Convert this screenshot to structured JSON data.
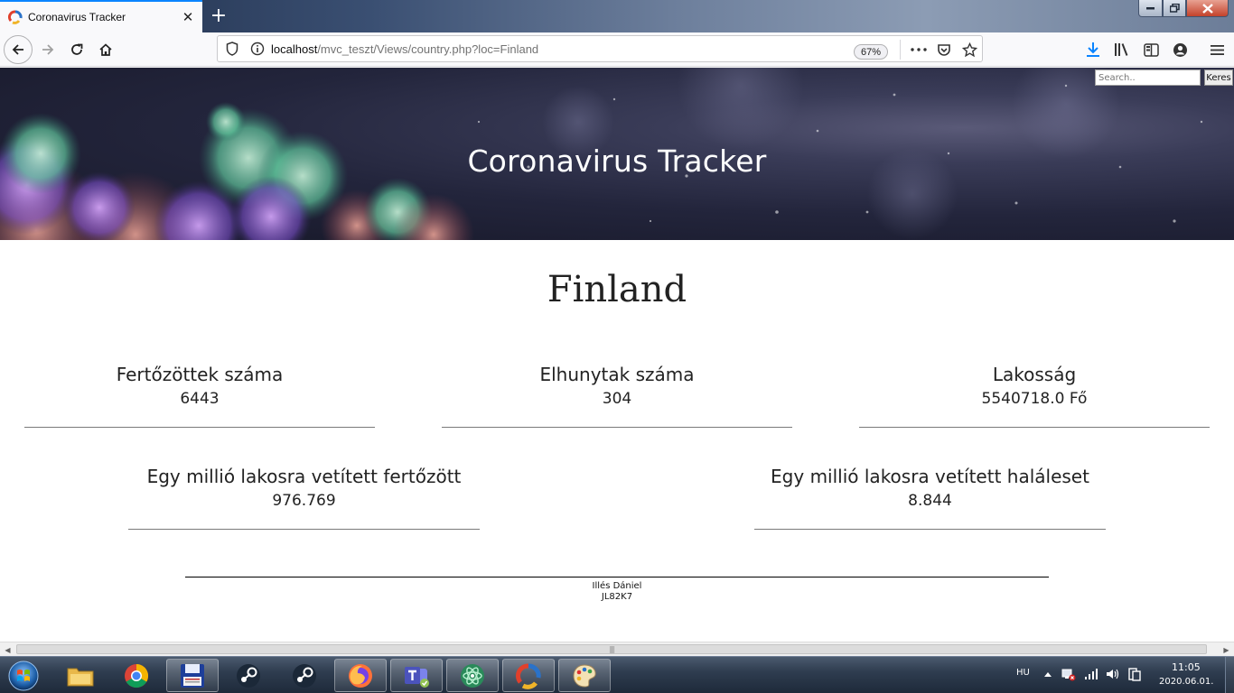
{
  "browser": {
    "tab_title": "Coronavirus Tracker",
    "url_host": "localhost",
    "url_path": "/mvc_teszt/Views/country.php?loc=Finland",
    "zoom": "67%"
  },
  "page": {
    "header_title": "Coronavirus Tracker",
    "search_placeholder": "Search..",
    "search_button": "Keres",
    "country": "Finland",
    "stats_row1": [
      {
        "label": "Fertőzöttek száma",
        "value": "6443"
      },
      {
        "label": "Elhunytak száma",
        "value": "304"
      },
      {
        "label": "Lakosság",
        "value": "5540718.0 Fő"
      }
    ],
    "stats_row2": [
      {
        "label": "Egy millió lakosra vetített fertőzött",
        "value": "976.769"
      },
      {
        "label": "Egy millió lakosra vetített haláleset",
        "value": "8.844"
      }
    ],
    "footer": {
      "author": "Illés Dániel",
      "code": "JL82K7"
    }
  },
  "taskbar": {
    "language": "HU",
    "time": "11:05",
    "date": "2020.06.01."
  },
  "colors": {
    "accent": "#0a84ff",
    "download_icon": "#0a84ff",
    "page_text": "#222222"
  }
}
